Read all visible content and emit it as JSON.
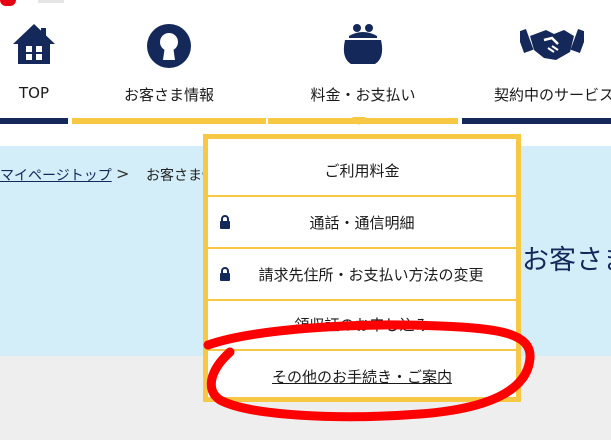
{
  "nav": {
    "items": [
      {
        "label": "TOP",
        "icon": "home-icon"
      },
      {
        "label": "お客さま情報",
        "icon": "customer-icon"
      },
      {
        "label": "料金・お支払い",
        "icon": "purse-icon"
      },
      {
        "label": "契約中のサービス",
        "icon": "handshake-icon"
      }
    ]
  },
  "breadcrumb": {
    "link": "マイページトップ",
    "separator": ">",
    "current": "お客さま情報"
  },
  "page": {
    "title": "お客さま情報"
  },
  "dropdown": {
    "items": [
      {
        "label": "ご利用料金",
        "locked": false
      },
      {
        "label": "通話・通信明細",
        "locked": true
      },
      {
        "label": "請求先住所・お支払い方法の変更",
        "locked": true
      },
      {
        "label": "領収証のお申し込み",
        "locked": false
      },
      {
        "label": "その他のお手続き・ご案内",
        "locked": false
      }
    ]
  },
  "colors": {
    "navy": "#14285a",
    "yellow": "#f7c843",
    "band": "#d3eef8",
    "annotation": "#ff0000"
  }
}
